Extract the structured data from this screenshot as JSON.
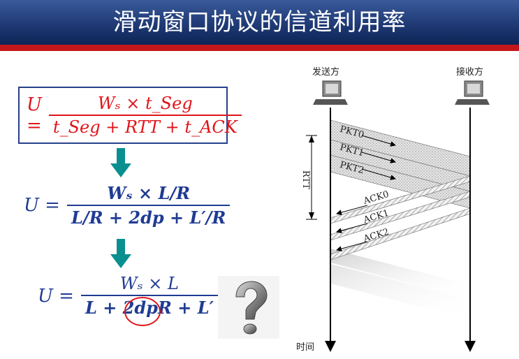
{
  "header": {
    "title": "滑动窗口协议的信道利用率"
  },
  "formulas": {
    "f1": {
      "lhs": "U =",
      "numerator": "Wₛ × t_Seg",
      "denominator": "t_Seg + RTT + t_ACK"
    },
    "f2": {
      "lhs": "U =",
      "numerator": "Wₛ × L/R",
      "denominator": "L/R + 2dp + L′/R"
    },
    "f3": {
      "lhs": "U =",
      "numerator": "Wₛ × L",
      "denominator": "L + 2dpR + L′"
    }
  },
  "diagram": {
    "sender_label": "发送方",
    "receiver_label": "接收方",
    "time_label": "时间",
    "rtt_label": "RTT",
    "packets": [
      "PKT0",
      "PKT1",
      "PKT2"
    ],
    "acks": [
      "ACK0",
      "ACK1",
      "ACK2"
    ]
  },
  "icons": {
    "question": "question-mark-icon",
    "computer": "computer-icon",
    "arrow": "teal-down-arrow-icon"
  },
  "colors": {
    "title_bg": "#1f3a75",
    "title_stripe": "#c4171c",
    "formula_red": "#e0141a",
    "formula_blue": "#1f3b93",
    "arrow_teal": "#0a8f8f"
  }
}
